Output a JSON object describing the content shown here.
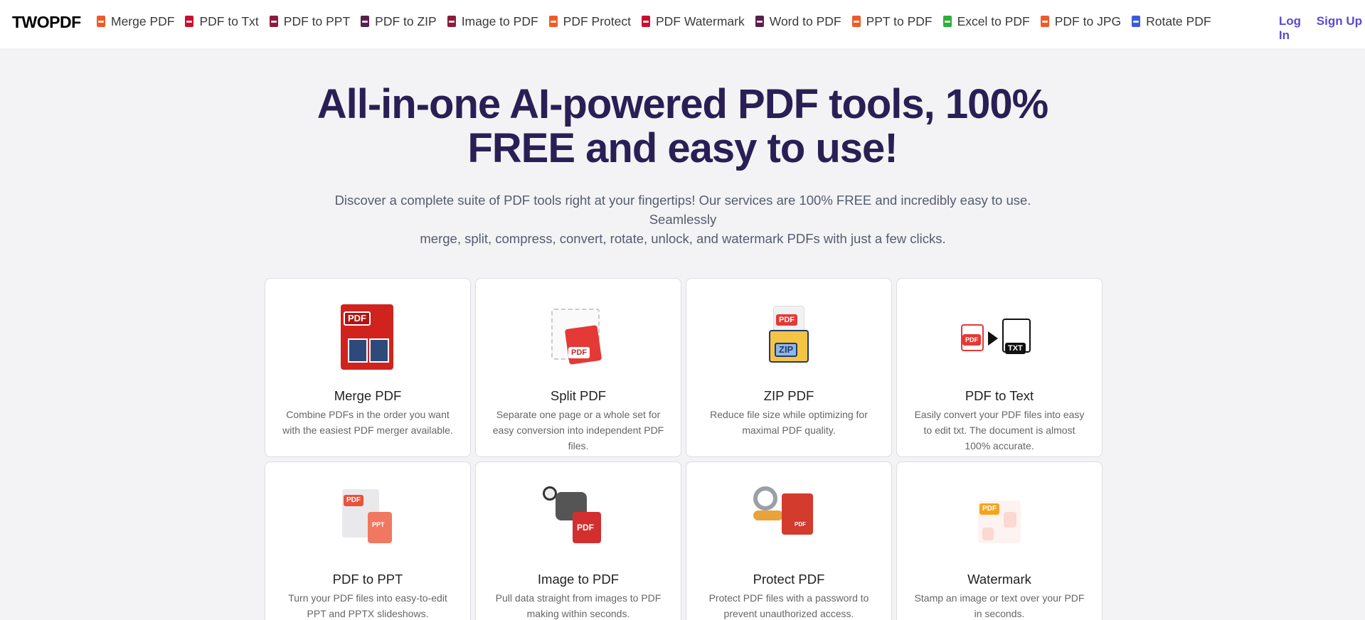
{
  "brand": {
    "logo_text": "TWOPDF"
  },
  "nav": {
    "links": [
      {
        "label": "Merge PDF",
        "icon": "pdf-file-icon",
        "color": "#f05a28"
      },
      {
        "label": "PDF to Txt",
        "icon": "pdf-file-icon",
        "color": "#c8102e"
      },
      {
        "label": "PDF to PPT",
        "icon": "pdf-file-icon",
        "color": "#8b1c3c"
      },
      {
        "label": "PDF to ZIP",
        "icon": "pdf-file-icon",
        "color": "#5a1f4f"
      },
      {
        "label": "Image to PDF",
        "icon": "pdf-file-icon",
        "color": "#8b1c3c"
      },
      {
        "label": "PDF Protect",
        "icon": "pdf-file-icon",
        "color": "#f05a28"
      },
      {
        "label": "PDF Watermark",
        "icon": "pdf-file-icon",
        "color": "#c8102e"
      },
      {
        "label": "Word to PDF",
        "icon": "pdf-file-icon",
        "color": "#5a1f4f"
      },
      {
        "label": "PPT to PDF",
        "icon": "pdf-file-icon",
        "color": "#f05a28"
      },
      {
        "label": "Excel to PDF",
        "icon": "excel-file-icon",
        "color": "#2fae3b"
      },
      {
        "label": "PDF to JPG",
        "icon": "pdf-file-icon",
        "color": "#f05a28"
      },
      {
        "label": "Rotate PDF",
        "icon": "pdf-file-icon",
        "color": "#3b5bdb"
      }
    ],
    "login": "Log In",
    "signup": "Sign Up"
  },
  "hero": {
    "title_line1": "All-in-one AI-powered PDF tools, 100%",
    "title_line2": "FREE and easy to use!",
    "subtitle_line1": "Discover a complete suite of PDF tools right at your fingertips! Our services are 100% FREE and incredibly easy to use. Seamlessly",
    "subtitle_line2": "merge, split, compress, convert, rotate, unlock, and watermark PDFs with just a few clicks."
  },
  "tools": [
    {
      "title": "Merge PDF",
      "desc": "Combine PDFs in the order you want with the easiest PDF merger available.",
      "icon": "merge-pdf-icon",
      "art_tag": "PDF"
    },
    {
      "title": "Split PDF",
      "desc": "Separate one page or a whole set for easy conversion into independent PDF files.",
      "icon": "split-pdf-icon",
      "art_tag": "PDF"
    },
    {
      "title": "ZIP PDF",
      "desc": "Reduce file size while optimizing for maximal PDF quality.",
      "icon": "zip-pdf-icon",
      "art_tag": "PDF",
      "art_tag2": "ZIP"
    },
    {
      "title": "PDF to Text",
      "desc": "Easily convert your PDF files into easy to edit txt. The document is almost 100% accurate.",
      "icon": "pdf-to-text-icon",
      "art_tag": "PDF",
      "art_tag2": "TXT"
    },
    {
      "title": "PDF to PPT",
      "desc": "Turn your PDF files into easy-to-edit PPT and PPTX slideshows.",
      "icon": "pdf-to-ppt-icon",
      "art_tag": "PDF",
      "art_tag2": "PPT"
    },
    {
      "title": "Image to PDF",
      "desc": "Pull data straight from images to PDF making within seconds.",
      "icon": "image-to-pdf-icon",
      "art_tag": "PDF"
    },
    {
      "title": "Protect PDF",
      "desc": "Protect PDF files with a password to prevent unauthorized access.",
      "icon": "protect-pdf-icon",
      "art_tag": "PDF"
    },
    {
      "title": "Watermark",
      "desc": "Stamp an image or text over your PDF in seconds.",
      "icon": "watermark-icon",
      "art_tag": "PDF"
    }
  ]
}
